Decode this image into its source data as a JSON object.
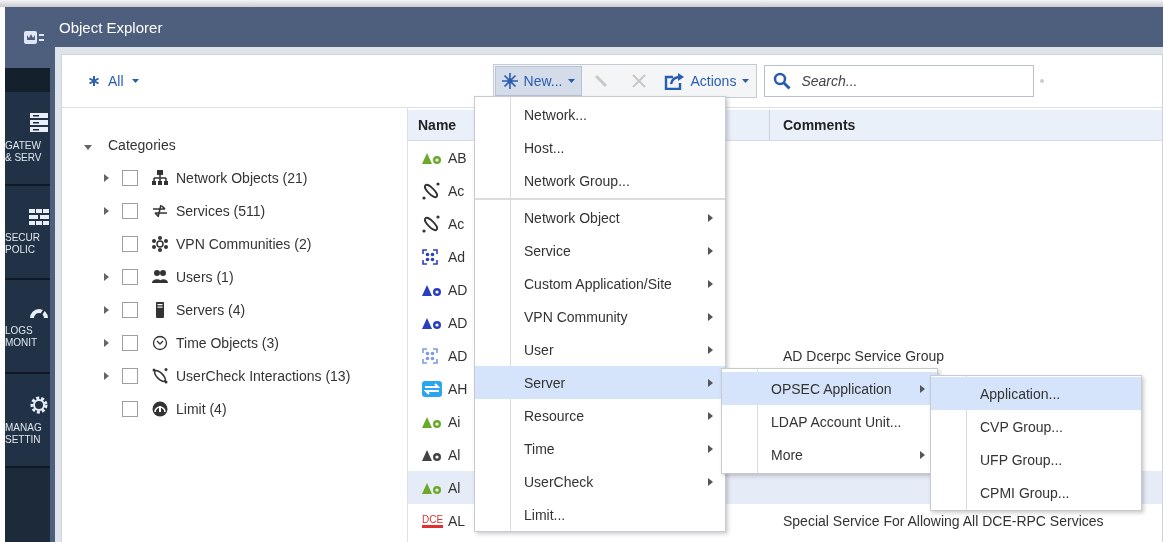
{
  "window": {
    "title": "Object Explorer"
  },
  "rail": {
    "items": [
      {
        "kind": "gateways",
        "label": "GATEW\n& SERV"
      },
      {
        "kind": "policy",
        "label": "SECUR\nPOLIC"
      },
      {
        "kind": "logs",
        "label": "LOGS\nMONIT"
      },
      {
        "kind": "settings",
        "label": "MANAG\nSETTIN"
      }
    ]
  },
  "filter": {
    "label": "All"
  },
  "toolbar": {
    "new_button": {
      "label": "New...",
      "pressed": true
    },
    "edit_disabled": true,
    "delete_disabled": true,
    "actions_button": {
      "label": "Actions"
    },
    "search": {
      "placeholder": "Search..."
    }
  },
  "tree": {
    "label": "Categories",
    "expanded": true,
    "children": [
      {
        "kind": "network",
        "label": "Network Objects (21)",
        "has_children": true,
        "checked": false
      },
      {
        "kind": "services",
        "label": "Services (511)",
        "has_children": true,
        "checked": false
      },
      {
        "kind": "vpn",
        "label": "VPN Communities (2)",
        "has_children": false,
        "checked": false
      },
      {
        "kind": "users",
        "label": "Users (1)",
        "has_children": true,
        "checked": false
      },
      {
        "kind": "server",
        "label": "Servers (4)",
        "has_children": true,
        "checked": false
      },
      {
        "kind": "time",
        "label": "Time Objects (3)",
        "has_children": true,
        "checked": false
      },
      {
        "kind": "usercheck",
        "label": "UserCheck Interactions (13)",
        "has_children": true,
        "checked": false
      },
      {
        "kind": "limit",
        "label": "Limit (4)",
        "has_children": false,
        "checked": false
      }
    ]
  },
  "table": {
    "columns": [
      "Name",
      "Comments"
    ],
    "rows": [
      {
        "kind": "host",
        "color": "#6aa92a",
        "name": "AB",
        "selected": false
      },
      {
        "kind": "usercheck",
        "color": "#333333",
        "name": "Ac",
        "selected": false
      },
      {
        "kind": "usercheck",
        "color": "#333333",
        "name": "Ac",
        "selected": false
      },
      {
        "kind": "group",
        "color": "#2a3fbf",
        "name": "Ad",
        "selected": false
      },
      {
        "kind": "host",
        "color": "#2a3fbf",
        "name": "AD",
        "selected": false
      },
      {
        "kind": "host",
        "color": "#2a3fbf",
        "name": "AD",
        "selected": false
      },
      {
        "kind": "group",
        "color": "#7d9be6",
        "name": "AD",
        "comments": "AD Dcerpc Service Group",
        "selected": false
      },
      {
        "kind": "exchange",
        "color": "#2aa6f0",
        "name": "AH",
        "selected": false
      },
      {
        "kind": "host",
        "color": "#6aa92a",
        "name": "Ai",
        "selected": false
      },
      {
        "kind": "host",
        "color": "#444444",
        "name": "Al",
        "selected": false
      },
      {
        "kind": "host",
        "color": "#6aa92a",
        "name": "Al",
        "selected": true
      },
      {
        "kind": "badge",
        "color": "#e03030",
        "badge_text": "DCE",
        "name": "AL",
        "comments": "Special Service For Allowing All DCE-RPC Services",
        "selected": false
      }
    ]
  },
  "new_menu": {
    "groups": [
      [
        {
          "label": "Network...",
          "has_submenu": false,
          "selected": false
        },
        {
          "label": "Host...",
          "has_submenu": false,
          "selected": false
        },
        {
          "label": "Network Group...",
          "has_submenu": false,
          "selected": false
        }
      ],
      [
        {
          "label": "Network Object",
          "has_submenu": true,
          "selected": false
        },
        {
          "label": "Service",
          "has_submenu": true,
          "selected": false
        },
        {
          "label": "Custom Application/Site",
          "has_submenu": true,
          "selected": false
        },
        {
          "label": "VPN Community",
          "has_submenu": true,
          "selected": false
        },
        {
          "label": "User",
          "has_submenu": true,
          "selected": false
        },
        {
          "label": "Server",
          "has_submenu": true,
          "selected": true
        },
        {
          "label": "Resource",
          "has_submenu": true,
          "selected": false
        },
        {
          "label": "Time",
          "has_submenu": true,
          "selected": false
        },
        {
          "label": "UserCheck",
          "has_submenu": true,
          "selected": false
        },
        {
          "label": "Limit...",
          "has_submenu": false,
          "selected": false
        }
      ]
    ]
  },
  "server_submenu": {
    "items": [
      {
        "label": "OPSEC Application",
        "has_submenu": true,
        "selected": true
      },
      {
        "label": "LDAP Account Unit...",
        "has_submenu": false,
        "selected": false
      },
      {
        "label": "More",
        "has_submenu": true,
        "selected": false
      }
    ]
  },
  "opsec_submenu": {
    "items": [
      {
        "label": "Application...",
        "has_submenu": false,
        "selected": true
      },
      {
        "label": "CVP Group...",
        "has_submenu": false,
        "selected": false
      },
      {
        "label": "UFP Group...",
        "has_submenu": false,
        "selected": false
      },
      {
        "label": "CPMI Group...",
        "has_submenu": false,
        "selected": false
      }
    ]
  }
}
